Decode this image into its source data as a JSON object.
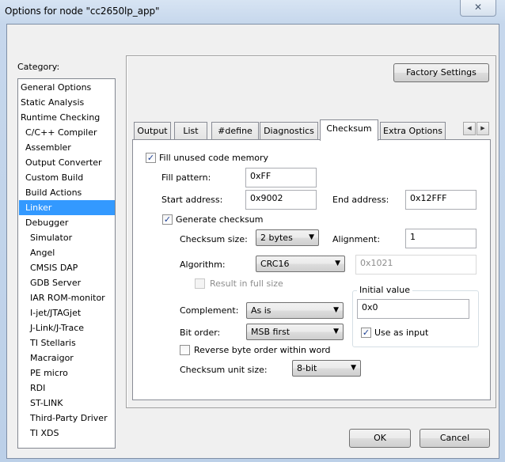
{
  "window": {
    "title": "Options for node \"cc2650lp_app\"",
    "close_glyph": "✕"
  },
  "category": {
    "label": "Category:",
    "items": [
      {
        "label": "General Options",
        "indent": 0
      },
      {
        "label": "Static Analysis",
        "indent": 0
      },
      {
        "label": "Runtime Checking",
        "indent": 0
      },
      {
        "label": "C/C++ Compiler",
        "indent": 1
      },
      {
        "label": "Assembler",
        "indent": 1
      },
      {
        "label": "Output Converter",
        "indent": 1
      },
      {
        "label": "Custom Build",
        "indent": 1
      },
      {
        "label": "Build Actions",
        "indent": 1
      },
      {
        "label": "Linker",
        "indent": 1,
        "selected": true
      },
      {
        "label": "Debugger",
        "indent": 1
      },
      {
        "label": "Simulator",
        "indent": 2
      },
      {
        "label": "Angel",
        "indent": 2
      },
      {
        "label": "CMSIS DAP",
        "indent": 2
      },
      {
        "label": "GDB Server",
        "indent": 2
      },
      {
        "label": "IAR ROM-monitor",
        "indent": 2
      },
      {
        "label": "I-jet/JTAGjet",
        "indent": 2
      },
      {
        "label": "J-Link/J-Trace",
        "indent": 2
      },
      {
        "label": "TI Stellaris",
        "indent": 2
      },
      {
        "label": "Macraigor",
        "indent": 2
      },
      {
        "label": "PE micro",
        "indent": 2
      },
      {
        "label": "RDI",
        "indent": 2
      },
      {
        "label": "ST-LINK",
        "indent": 2
      },
      {
        "label": "Third-Party Driver",
        "indent": 2
      },
      {
        "label": "TI XDS",
        "indent": 2
      }
    ]
  },
  "factory_settings_label": "Factory Settings",
  "tabs": [
    "Output",
    "List",
    "#define",
    "Diagnostics",
    "Checksum",
    "Extra Options"
  ],
  "active_tab": "Checksum",
  "tab_scroll": {
    "left": "◀",
    "right": "▶"
  },
  "checksum": {
    "fill_unused_label": "Fill unused code memory",
    "fill_unused_checked": true,
    "fill_pattern_label": "Fill pattern:",
    "fill_pattern_value": "0xFF",
    "start_address_label": "Start address:",
    "start_address_value": "0x9002",
    "end_address_label": "End address:",
    "end_address_value": "0x12FFF",
    "generate_checksum_label": "Generate checksum",
    "generate_checksum_checked": true,
    "checksum_size_label": "Checksum size:",
    "checksum_size_value": "2 bytes",
    "alignment_label": "Alignment:",
    "alignment_value": "1",
    "algorithm_label": "Algorithm:",
    "algorithm_value": "CRC16",
    "polynomial_value": "0x1021",
    "result_full_size_label": "Result in full size",
    "result_full_size_checked": false,
    "initial_value_title": "Initial value",
    "initial_value": "0x0",
    "use_as_input_label": "Use as input",
    "use_as_input_checked": true,
    "complement_label": "Complement:",
    "complement_value": "As is",
    "bit_order_label": "Bit order:",
    "bit_order_value": "MSB first",
    "reverse_byte_label": "Reverse byte order within word",
    "reverse_byte_checked": false,
    "unit_size_label": "Checksum unit size:",
    "unit_size_value": "8-bit"
  },
  "ok_label": "OK",
  "cancel_label": "Cancel",
  "check_glyph": "✓",
  "dropdown_glyph": "▼"
}
